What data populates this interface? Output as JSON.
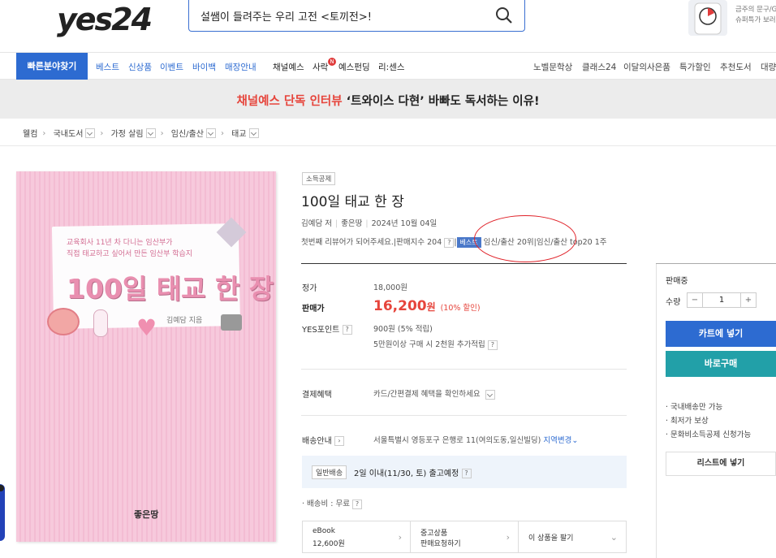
{
  "header": {
    "logo": "yes24",
    "search_value": "설쌤이 들려주는 우리 고전 <토끼전>!",
    "promo_line1": "금주의 문구/G",
    "promo_line2": "슈퍼특가 보러"
  },
  "nav": {
    "quick": "빠른분야찾기",
    "items": [
      "베스트",
      "신상품",
      "이벤트",
      "바이백",
      "매장안내",
      "채널예스",
      "사락",
      "예스펀딩",
      "리:센스"
    ],
    "new_badge": "N",
    "right_items": [
      "노벨문학상",
      "클래스24",
      "이달의사은품",
      "특가할인",
      "추천도서",
      "대량"
    ]
  },
  "banner": {
    "part1": "채널예스 단독 인터뷰",
    "part2": " ‘트와이스 다현’ 바빠도 독서하는 이유!"
  },
  "breadcrumb": [
    "웰컴",
    "국내도서",
    "가정 살림",
    "임신/출산",
    "태교"
  ],
  "cover": {
    "subtitle1": "교육회사 11년 차 다니는 임산부가",
    "subtitle2": "직접 태교하고 싶어서 만든 임산부 학습지",
    "title": "100일 태교 한 장",
    "author": "김예담 지음",
    "publisher": "좋은땅"
  },
  "book": {
    "badge": "소득공제",
    "title": "100일 태교 한 장",
    "author": "김예담 저",
    "publisher": "좋은땅",
    "date": "2024년 10월 04일",
    "review": "첫번째 리뷰어가 되어주세요.",
    "sales_index": "판매지수 204",
    "best_tag": "베스트",
    "rank": "임신/출산 20위",
    "rank2": "임신/출산 top20 1주"
  },
  "price": {
    "list_label": "정가",
    "list_value": "18,000원",
    "sale_label": "판매가",
    "sale_value": "16,200",
    "sale_unit": "원",
    "sale_discount": "(10% 할인)",
    "point_label": "YES포인트",
    "point_value": "900원 (5% 적립)",
    "point_extra": "5만원이상 구매 시 2천원 추가적립",
    "benefit_label": "결제혜택",
    "benefit_value": "카드/간편결제 혜택을 확인하세요",
    "delivery_label": "배송안내",
    "delivery_value": "서울특별시 영등포구 은행로 11(여의도동,일신빌딩)",
    "delivery_change": "지역변경",
    "ship_tag": "일반배송",
    "ship_info": "2일 이내(11/30, 토) 출고예정",
    "ship_fee": "· 배송비 : 무료"
  },
  "bottom_boxes": {
    "ebook_label": "eBook",
    "ebook_price": "12,600원",
    "used_label": "중고상품",
    "used_action": "판매요청하기",
    "sell_label": "이 상품을 팔기"
  },
  "sidebar": {
    "status": "판매중",
    "qty_label": "수량",
    "qty_minus": "−",
    "qty_value": "1",
    "qty_plus": "+",
    "cart": "카트에 넣기",
    "buy": "바로구매",
    "notes": [
      "· 국내배송만 가능",
      "· 최저가 보상",
      "· 문화비소득공제 신청가능"
    ],
    "list": "리스트에 넣기"
  },
  "colors": {
    "brand_blue": "#2d6bd1",
    "sale_red": "#e6453c",
    "buy_teal": "#22a0a8",
    "annotation_red": "#e0232a"
  }
}
